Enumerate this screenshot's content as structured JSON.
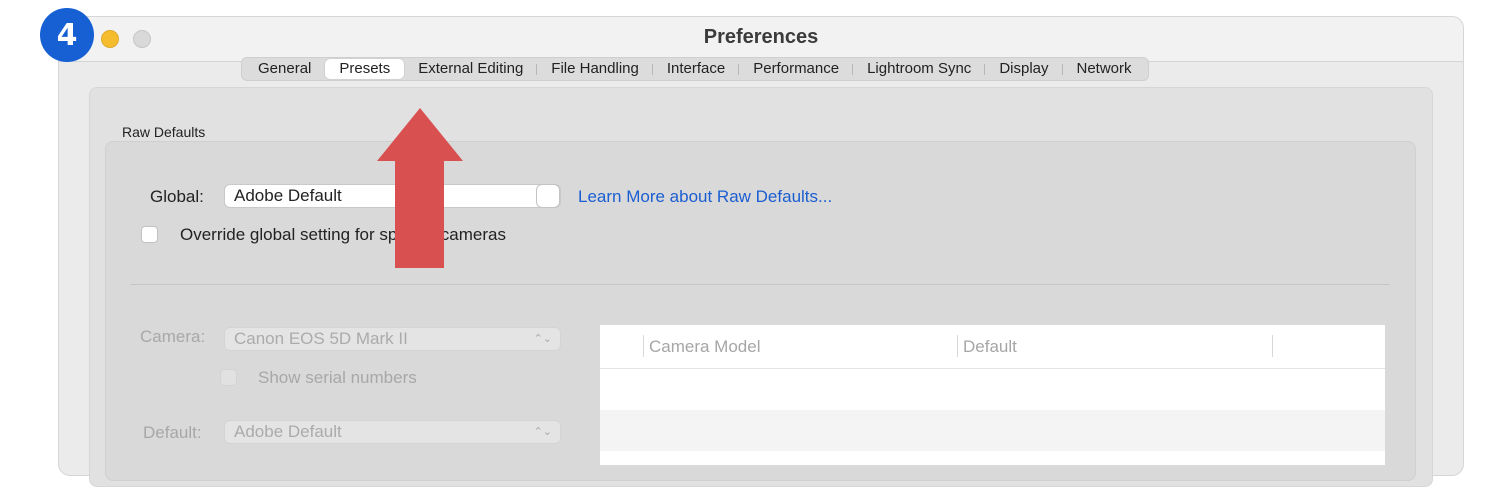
{
  "window": {
    "title": "Preferences"
  },
  "badge": {
    "step": "4"
  },
  "tabs": [
    {
      "label": "General",
      "selected": false
    },
    {
      "label": "Presets",
      "selected": true
    },
    {
      "label": "External Editing",
      "selected": false
    },
    {
      "label": "File Handling",
      "selected": false
    },
    {
      "label": "Interface",
      "selected": false
    },
    {
      "label": "Performance",
      "selected": false
    },
    {
      "label": "Lightroom Sync",
      "selected": false
    },
    {
      "label": "Display",
      "selected": false
    },
    {
      "label": "Network",
      "selected": false
    }
  ],
  "raw_defaults": {
    "section_label": "Raw Defaults",
    "global_label": "Global:",
    "global_value": "Adobe Default",
    "learn_more_link": "Learn More about Raw Defaults...",
    "override_label": "Override global setting for specific cameras",
    "override_checked": false,
    "camera_label": "Camera:",
    "camera_value": "Canon EOS 5D Mark II",
    "show_serial_label": "Show serial numbers",
    "default_label": "Default:",
    "default_value": "Adobe Default"
  },
  "table": {
    "columns": [
      "Camera Model",
      "Default"
    ],
    "rows": []
  },
  "annotation": {
    "arrow_color": "#d95050",
    "badge_color": "#1660d4"
  }
}
